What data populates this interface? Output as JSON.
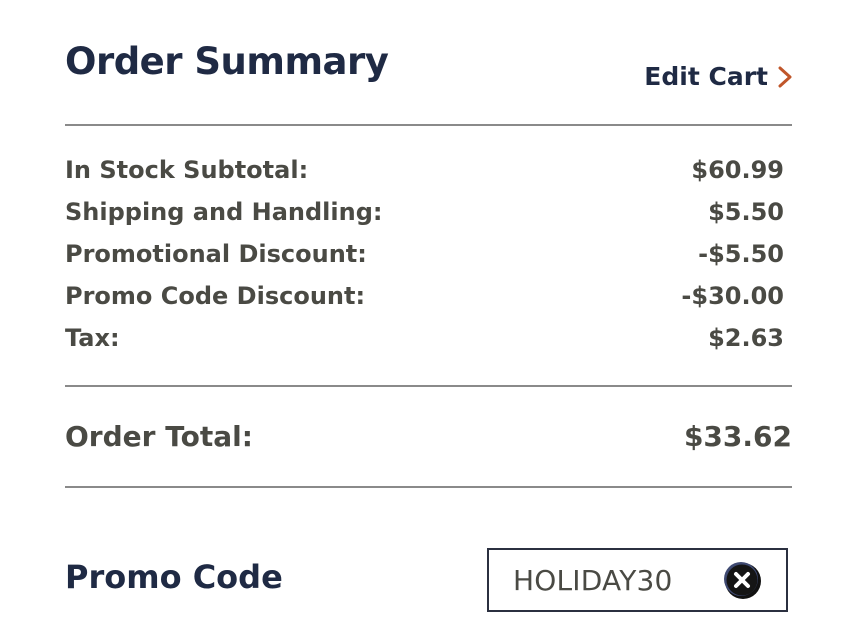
{
  "order_summary": {
    "title": "Order Summary",
    "edit_cart_label": "Edit Cart",
    "lines": [
      {
        "label": "In Stock Subtotal:",
        "value": "$60.99"
      },
      {
        "label": "Shipping and Handling:",
        "value": "$5.50"
      },
      {
        "label": "Promotional Discount:",
        "value": "-$5.50"
      },
      {
        "label": "Promo Code Discount:",
        "value": "-$30.00"
      },
      {
        "label": "Tax:",
        "value": "$2.63"
      }
    ],
    "total": {
      "label": "Order Total:",
      "value": "$33.62"
    }
  },
  "promo": {
    "title": "Promo Code",
    "applied_code": "HOLIDAY30"
  },
  "colors": {
    "heading": "#1f2a44",
    "text": "#4a4a44",
    "accent": "#c0562a",
    "divider": "#8a8a8a"
  },
  "icons": {
    "edit_cart": "chevron-right-icon",
    "remove_code": "close-circle-icon"
  }
}
